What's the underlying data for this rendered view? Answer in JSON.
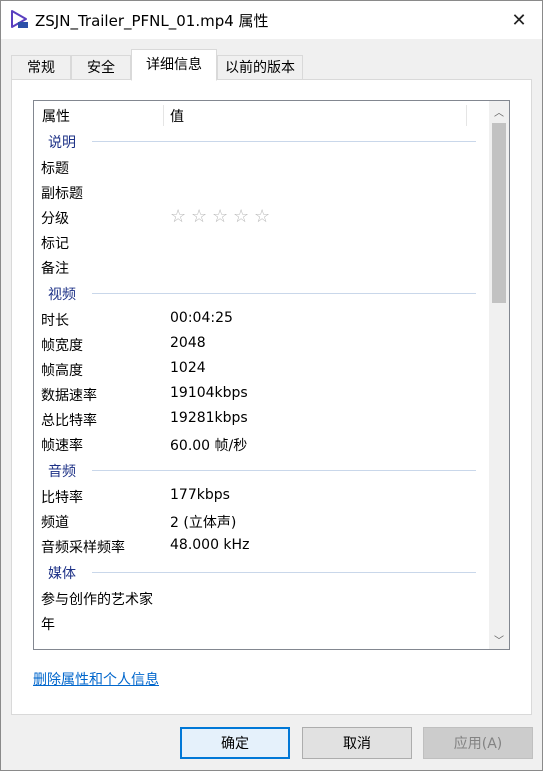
{
  "window": {
    "title": "ZSJN_Trailer_PFNL_01.mp4 属性",
    "app_icon": "video-file-icon",
    "close_glyph": "✕"
  },
  "tabs": [
    {
      "label": "常规"
    },
    {
      "label": "安全"
    },
    {
      "label": "详细信息"
    },
    {
      "label": "以前的版本"
    }
  ],
  "list": {
    "headers": {
      "property": "属性",
      "value": "值"
    },
    "groups": {
      "description": {
        "label": "说明",
        "rows": [
          {
            "key": "标题",
            "value": ""
          },
          {
            "key": "副标题",
            "value": ""
          },
          {
            "key": "分级",
            "value": "",
            "rating_stars": 0,
            "rating_max": 5
          },
          {
            "key": "标记",
            "value": ""
          },
          {
            "key": "备注",
            "value": ""
          }
        ]
      },
      "video": {
        "label": "视频",
        "rows": [
          {
            "key": "时长",
            "value": "00:04:25"
          },
          {
            "key": "帧宽度",
            "value": "2048"
          },
          {
            "key": "帧高度",
            "value": "1024"
          },
          {
            "key": "数据速率",
            "value": "19104kbps"
          },
          {
            "key": "总比特率",
            "value": "19281kbps"
          },
          {
            "key": "帧速率",
            "value": "60.00 帧/秒"
          }
        ]
      },
      "audio": {
        "label": "音频",
        "rows": [
          {
            "key": "比特率",
            "value": "177kbps"
          },
          {
            "key": "频道",
            "value": "2 (立体声)"
          },
          {
            "key": "音频采样频率",
            "value": "48.000 kHz"
          }
        ]
      },
      "media": {
        "label": "媒体",
        "rows": [
          {
            "key": "参与创作的艺术家",
            "value": ""
          },
          {
            "key": "年",
            "value": ""
          }
        ]
      }
    },
    "star_glyph": "☆",
    "scroll_up_glyph": "︿",
    "scroll_down_glyph": "﹀"
  },
  "remove_link": "删除属性和个人信息",
  "buttons": {
    "ok": "确定",
    "cancel": "取消",
    "apply": "应用(A)"
  },
  "colors": {
    "accent": "#0078d7",
    "group_label": "#1e3287",
    "link": "#0066cc"
  }
}
